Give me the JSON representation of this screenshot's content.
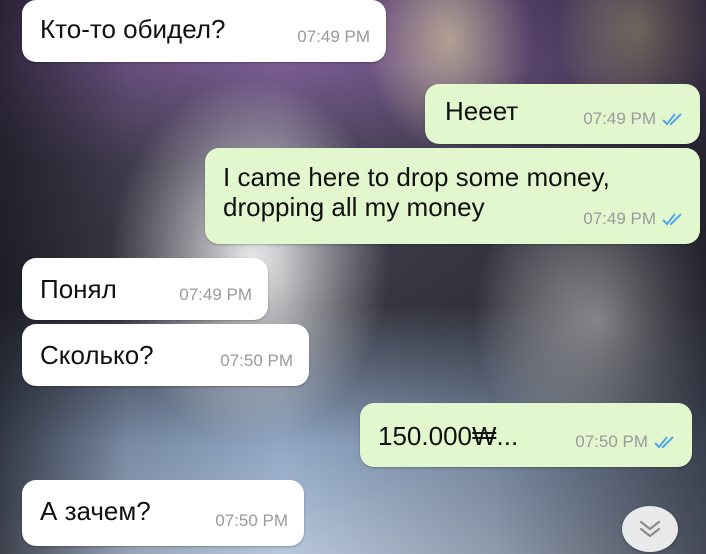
{
  "messages": [
    {
      "text": "Кто-то обидел?",
      "time": "07:49 PM",
      "direction": "incoming"
    },
    {
      "text": "Нееет",
      "time": "07:49 PM",
      "direction": "outgoing",
      "status": "read-double-check"
    },
    {
      "text": "I came here to drop some money,\ndropping all my money",
      "time": "07:49 PM",
      "direction": "outgoing",
      "status": "read-double-check"
    },
    {
      "text": "Понял",
      "time": "07:49 PM",
      "direction": "incoming"
    },
    {
      "text": "Сколько?",
      "time": "07:50 PM",
      "direction": "incoming"
    },
    {
      "text": "150.000₩...",
      "time": "07:50 PM",
      "direction": "outgoing",
      "status": "read-double-check"
    },
    {
      "text": "А зачем?",
      "time": "07:50 PM",
      "direction": "incoming"
    }
  ],
  "colors": {
    "incoming_bubble": "#ffffff",
    "outgoing_bubble": "#e3f7cf",
    "timestamp": "#9a9a9a",
    "read_check": "#4fa8e6"
  },
  "icons": {
    "read_receipt": "double-check-icon",
    "scroll_down": "chevrons-down-icon"
  }
}
